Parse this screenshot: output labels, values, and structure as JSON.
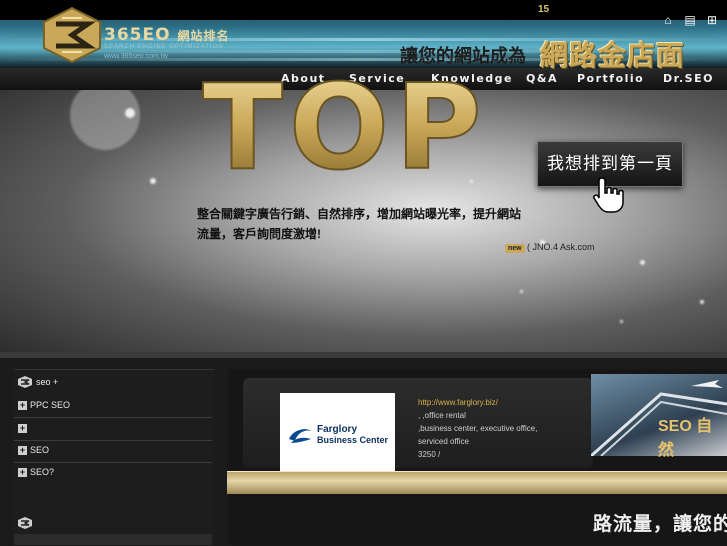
{
  "header": {
    "counter": "15",
    "logo": {
      "brand": "365EO",
      "brand_zh": "網站排名",
      "tagline": "SEARCH ENGINE OPTIMIZATION",
      "url": "www.365seo.com.tw"
    },
    "icons": [
      "home-icon",
      "bookmark-icon",
      "sitemap-icon"
    ]
  },
  "nav": {
    "items": [
      {
        "label": "About"
      },
      {
        "label": "Service"
      },
      {
        "label": "Knowledge"
      },
      {
        "label": "Q&A"
      },
      {
        "label": "Portfolio"
      },
      {
        "label": "Dr.SEO"
      }
    ]
  },
  "banner": {
    "headline": "讓您的網站成為",
    "headline_big": "網路金店面",
    "top_word": "TOP",
    "cta": "我想排到第一頁",
    "description": "整合關鍵字廣告行銷、自然排序，增加網站曝光率，提升網站流量，客戶詢問度激增!",
    "badge": "new",
    "news": "(      JNO.4  Ask.com"
  },
  "sidebar": {
    "title": "seo  +",
    "items": [
      {
        "label": "PPC SEO"
      },
      {
        "label": ""
      },
      {
        "label": "SEO"
      },
      {
        "label": " SEO?"
      }
    ]
  },
  "partner": {
    "name_line1": "Farglory",
    "name_line2": "Business Center",
    "link": "http://www.farglory.biz/",
    "info": [
      "         ,         ,office rental",
      ",business center, executive office,",
      "serviced office",
      "      3250 /"
    ]
  },
  "ad": {
    "text": "SEO 自然"
  },
  "bottom_text": "路流量，讓您的",
  "colors": {
    "gold": "#caa858",
    "nav_bg": "#111111",
    "page_bg": "#1b1b1b"
  }
}
